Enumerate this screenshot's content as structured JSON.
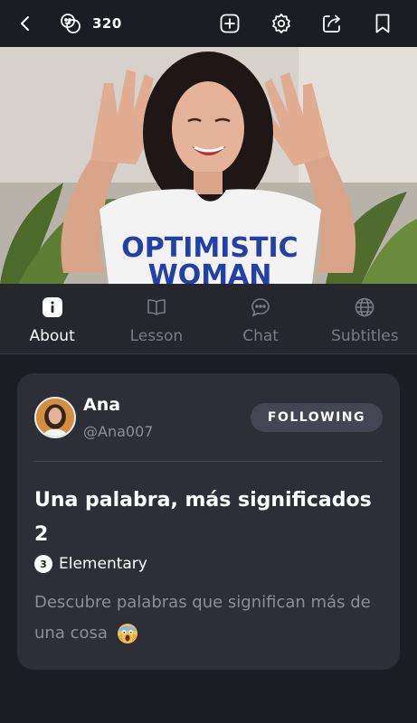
{
  "topbar": {
    "coins": "320",
    "icons": [
      "back-icon",
      "coins-icon",
      "add-icon",
      "settings-icon",
      "share-icon",
      "bookmark-icon"
    ]
  },
  "tabs": [
    {
      "label": "About",
      "icon": "info-icon",
      "active": true
    },
    {
      "label": "Lesson",
      "icon": "book-icon",
      "active": false
    },
    {
      "label": "Chat",
      "icon": "chat-icon",
      "active": false
    },
    {
      "label": "Subtitles",
      "icon": "globe-icon",
      "active": false
    }
  ],
  "video": {
    "shirt_text_line1": "OPTIMISTIC",
    "shirt_text_line2": "WOMAN"
  },
  "author": {
    "name": "Ana",
    "handle": "@Ana007",
    "follow_label": "FOLLOWING"
  },
  "lesson": {
    "title": "Una palabra, más significados 2",
    "level_number": "3",
    "level_label": "Elementary",
    "description": "Descubre palabras que significan más de una cosa",
    "description_emoji": "screaming-face-emoji"
  },
  "colors": {
    "background": "#1c1d22",
    "tabbar": "#26272d",
    "card": "#2d2e36",
    "button": "#444653",
    "muted_text": "#8c8e98"
  }
}
